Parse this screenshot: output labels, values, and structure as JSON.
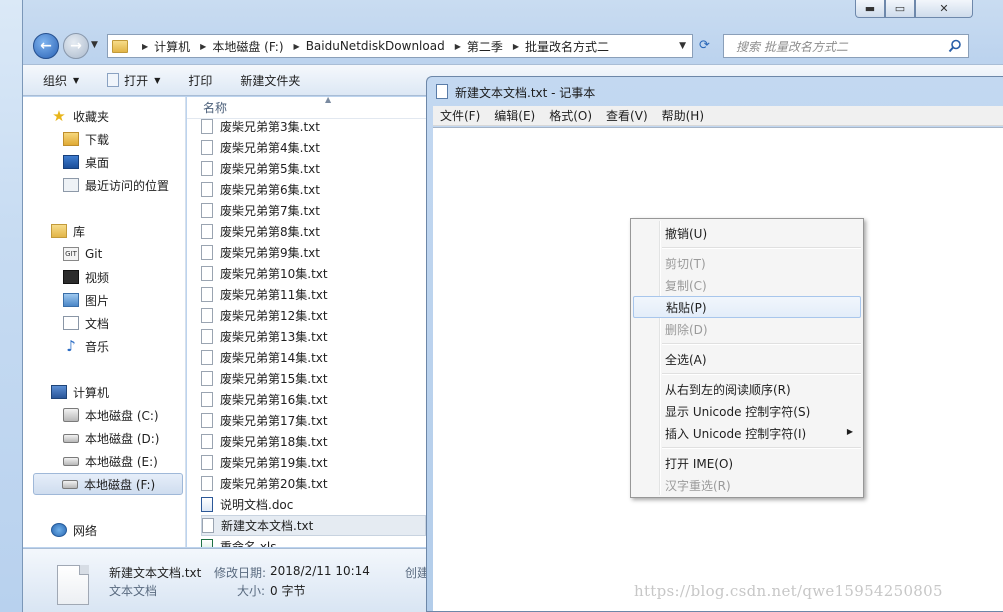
{
  "explorer": {
    "breadcrumb": [
      "计算机",
      "本地磁盘 (F:)",
      "BaiduNetdiskDownload",
      "第二季",
      "批量改名方式二"
    ],
    "search_placeholder": "搜索 批量改名方式二",
    "toolbar": {
      "organize": "组织",
      "open": "打开",
      "print": "打印",
      "new_folder": "新建文件夹"
    },
    "sidebar": {
      "favorites": "收藏夹",
      "downloads": "下载",
      "desktop": "桌面",
      "recent": "最近访问的位置",
      "libraries": "库",
      "git": "Git",
      "videos": "视频",
      "pictures": "图片",
      "documents": "文档",
      "music": "音乐",
      "computer": "计算机",
      "drive_c": "本地磁盘 (C:)",
      "drive_d": "本地磁盘 (D:)",
      "drive_e": "本地磁盘 (E:)",
      "drive_f": "本地磁盘 (F:)",
      "network": "网络"
    },
    "column_name": "名称",
    "files": [
      {
        "name": "废柴兄弟第3集.txt",
        "type": "txt"
      },
      {
        "name": "废柴兄弟第4集.txt",
        "type": "txt"
      },
      {
        "name": "废柴兄弟第5集.txt",
        "type": "txt"
      },
      {
        "name": "废柴兄弟第6集.txt",
        "type": "txt"
      },
      {
        "name": "废柴兄弟第7集.txt",
        "type": "txt"
      },
      {
        "name": "废柴兄弟第8集.txt",
        "type": "txt"
      },
      {
        "name": "废柴兄弟第9集.txt",
        "type": "txt"
      },
      {
        "name": "废柴兄弟第10集.txt",
        "type": "txt"
      },
      {
        "name": "废柴兄弟第11集.txt",
        "type": "txt"
      },
      {
        "name": "废柴兄弟第12集.txt",
        "type": "txt"
      },
      {
        "name": "废柴兄弟第13集.txt",
        "type": "txt"
      },
      {
        "name": "废柴兄弟第14集.txt",
        "type": "txt"
      },
      {
        "name": "废柴兄弟第15集.txt",
        "type": "txt"
      },
      {
        "name": "废柴兄弟第16集.txt",
        "type": "txt"
      },
      {
        "name": "废柴兄弟第17集.txt",
        "type": "txt"
      },
      {
        "name": "废柴兄弟第18集.txt",
        "type": "txt"
      },
      {
        "name": "废柴兄弟第19集.txt",
        "type": "txt"
      },
      {
        "name": "废柴兄弟第20集.txt",
        "type": "txt"
      },
      {
        "name": "说明文档.doc",
        "type": "doc"
      },
      {
        "name": "新建文本文档.txt",
        "type": "txt"
      },
      {
        "name": "重命名.xls",
        "type": "xls"
      }
    ],
    "details": {
      "filename": "新建文本文档.txt",
      "filetype": "文本文档",
      "modified_label": "修改日期:",
      "modified_value": "2018/2/11 10:14",
      "size_label": "大小:",
      "size_value": "0 字节",
      "created_label": "创建"
    }
  },
  "notepad": {
    "title": "新建文本文档.txt - 记事本",
    "menu": [
      "文件(F)",
      "编辑(E)",
      "格式(O)",
      "查看(V)",
      "帮助(H)"
    ]
  },
  "context_menu": {
    "undo": "撤销(U)",
    "cut": "剪切(T)",
    "copy": "复制(C)",
    "paste": "粘贴(P)",
    "delete": "删除(D)",
    "select_all": "全选(A)",
    "rtl": "从右到左的阅读顺序(R)",
    "show_unicode": "显示 Unicode 控制字符(S)",
    "insert_unicode": "插入 Unicode 控制字符(I)",
    "open_ime": "打开 IME(O)",
    "reconversion": "汉字重选(R)"
  },
  "watermark": "https://blog.csdn.net/qwe15954250805"
}
